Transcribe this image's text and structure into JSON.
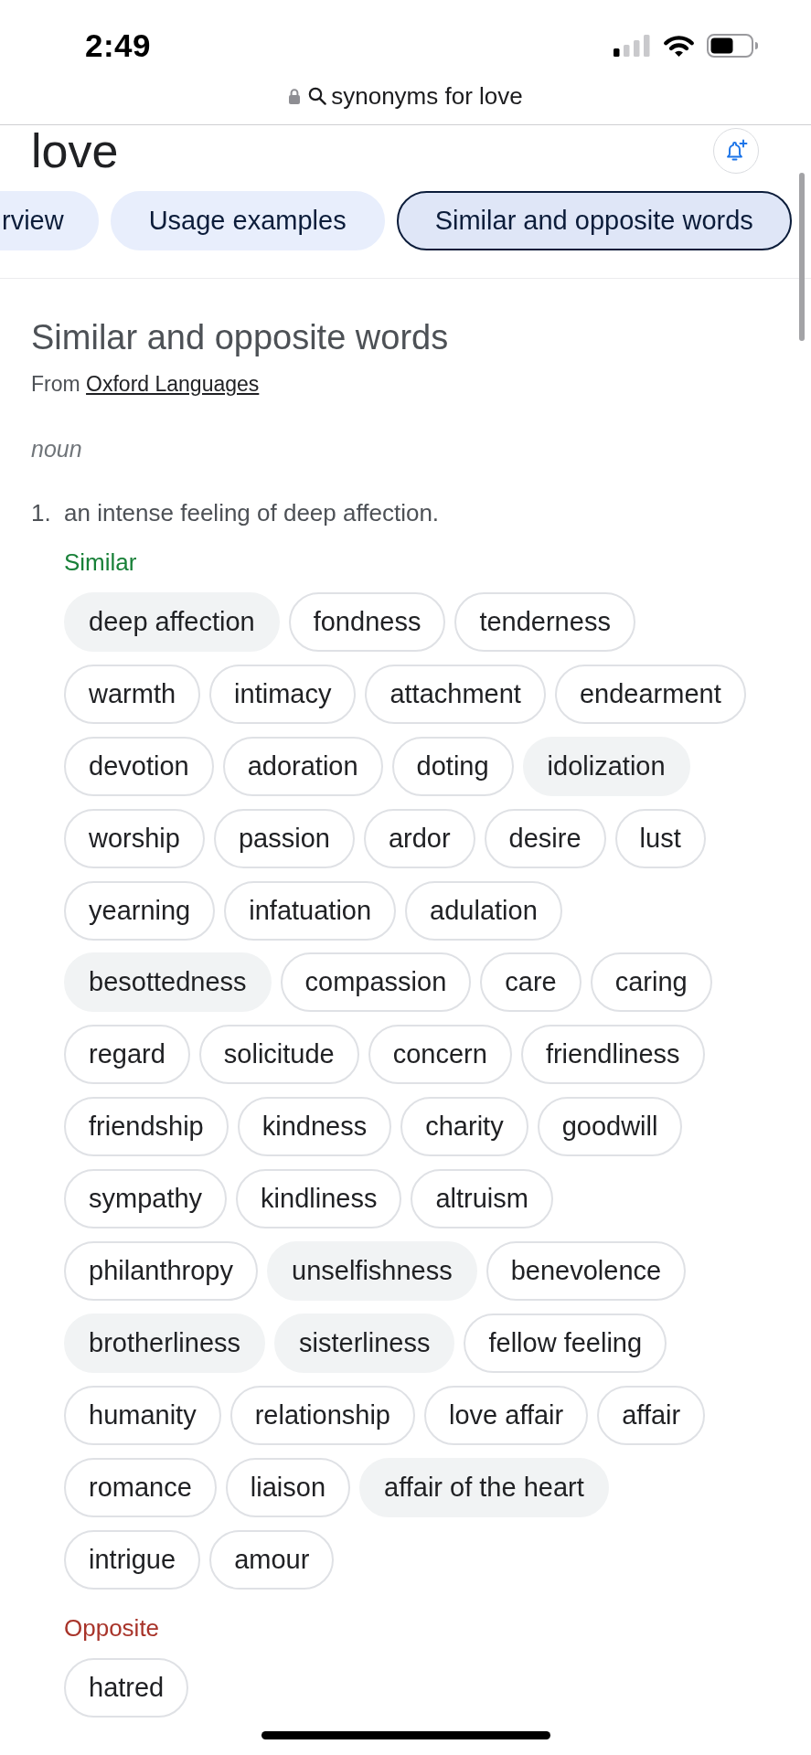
{
  "status_bar": {
    "time": "2:49"
  },
  "address_bar": {
    "text": "synonyms for love"
  },
  "header": {
    "title": "love"
  },
  "tabs": [
    {
      "label": "rview",
      "selected": false
    },
    {
      "label": "Usage examples",
      "selected": false
    },
    {
      "label": "Similar and opposite words",
      "selected": true
    }
  ],
  "section": {
    "title": "Similar and opposite words",
    "source_prefix": "From",
    "source_link": "Oxford Languages",
    "part_of_speech": "noun",
    "senses": [
      {
        "number": "1.",
        "definition": "an intense feeling of deep affection.",
        "groups": [
          {
            "kind": "similar",
            "label": "Similar",
            "rows": [
              [
                {
                  "word": "deep affection",
                  "outlined": false
                },
                {
                  "word": "fondness",
                  "outlined": true
                },
                {
                  "word": "tenderness",
                  "outlined": true
                }
              ],
              [
                {
                  "word": "warmth",
                  "outlined": true
                },
                {
                  "word": "intimacy",
                  "outlined": true
                },
                {
                  "word": "attachment",
                  "outlined": true
                },
                {
                  "word": "endearment",
                  "outlined": true
                }
              ],
              [
                {
                  "word": "devotion",
                  "outlined": true
                },
                {
                  "word": "adoration",
                  "outlined": true
                },
                {
                  "word": "doting",
                  "outlined": true
                },
                {
                  "word": "idolization",
                  "outlined": false
                }
              ],
              [
                {
                  "word": "worship",
                  "outlined": true
                },
                {
                  "word": "passion",
                  "outlined": true
                },
                {
                  "word": "ardor",
                  "outlined": true
                },
                {
                  "word": "desire",
                  "outlined": true
                },
                {
                  "word": "lust",
                  "outlined": true
                }
              ],
              [
                {
                  "word": "yearning",
                  "outlined": true
                },
                {
                  "word": "infatuation",
                  "outlined": true
                },
                {
                  "word": "adulation",
                  "outlined": true
                }
              ],
              [
                {
                  "word": "besottedness",
                  "outlined": false
                },
                {
                  "word": "compassion",
                  "outlined": true
                },
                {
                  "word": "care",
                  "outlined": true
                },
                {
                  "word": "caring",
                  "outlined": true
                }
              ],
              [
                {
                  "word": "regard",
                  "outlined": true
                },
                {
                  "word": "solicitude",
                  "outlined": true
                },
                {
                  "word": "concern",
                  "outlined": true
                },
                {
                  "word": "friendliness",
                  "outlined": true
                }
              ],
              [
                {
                  "word": "friendship",
                  "outlined": true
                },
                {
                  "word": "kindness",
                  "outlined": true
                },
                {
                  "word": "charity",
                  "outlined": true
                },
                {
                  "word": "goodwill",
                  "outlined": true
                }
              ],
              [
                {
                  "word": "sympathy",
                  "outlined": true
                },
                {
                  "word": "kindliness",
                  "outlined": true
                },
                {
                  "word": "altruism",
                  "outlined": true
                }
              ],
              [
                {
                  "word": "philanthropy",
                  "outlined": true
                },
                {
                  "word": "unselfishness",
                  "outlined": false
                },
                {
                  "word": "benevolence",
                  "outlined": true
                }
              ],
              [
                {
                  "word": "brotherliness",
                  "outlined": false
                },
                {
                  "word": "sisterliness",
                  "outlined": false
                },
                {
                  "word": "fellow feeling",
                  "outlined": true
                }
              ],
              [
                {
                  "word": "humanity",
                  "outlined": true
                },
                {
                  "word": "relationship",
                  "outlined": true
                },
                {
                  "word": "love affair",
                  "outlined": true
                },
                {
                  "word": "affair",
                  "outlined": true
                }
              ],
              [
                {
                  "word": "romance",
                  "outlined": true
                },
                {
                  "word": "liaison",
                  "outlined": true
                },
                {
                  "word": "affair of the heart",
                  "outlined": false
                }
              ],
              [
                {
                  "word": "intrigue",
                  "outlined": true
                },
                {
                  "word": "amour",
                  "outlined": true
                }
              ]
            ]
          },
          {
            "kind": "opposite",
            "label": "Opposite",
            "rows": [
              [
                {
                  "word": "hatred",
                  "outlined": true
                }
              ]
            ]
          }
        ]
      }
    ]
  }
}
